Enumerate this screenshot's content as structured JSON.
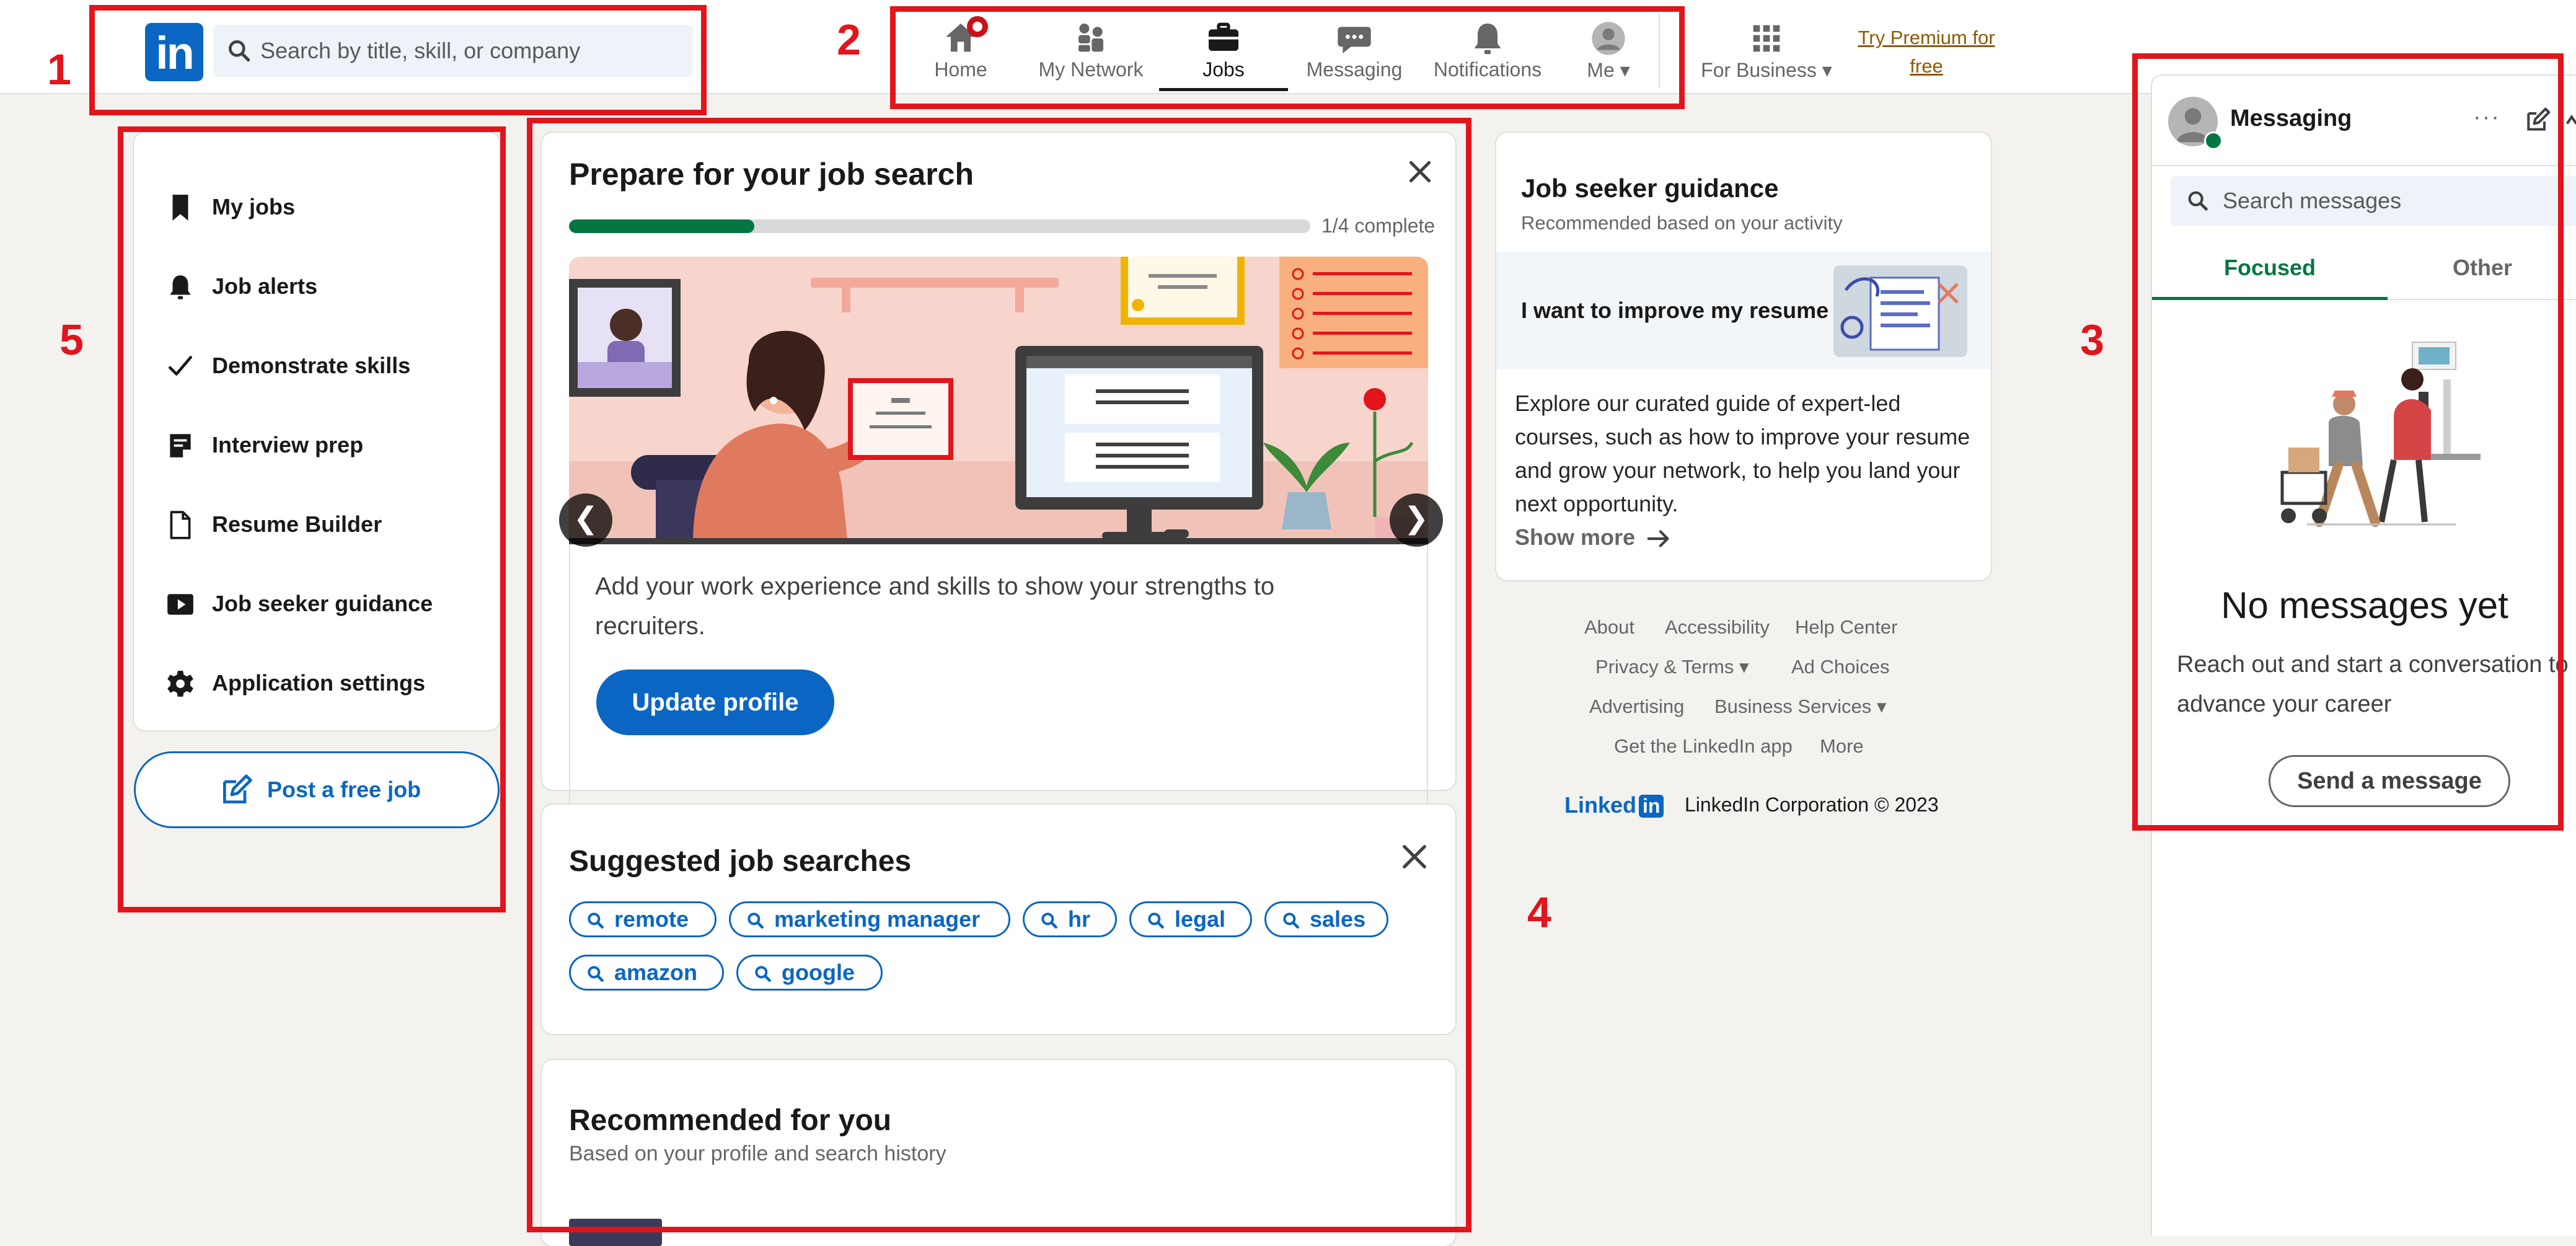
{
  "brand": {
    "logo_text": "in"
  },
  "header": {
    "search_placeholder": "Search by title, skill, or company",
    "nav": [
      {
        "id": "home",
        "label": "Home",
        "icon": "home-icon"
      },
      {
        "id": "network",
        "label": "My Network",
        "icon": "people-icon"
      },
      {
        "id": "jobs",
        "label": "Jobs",
        "icon": "briefcase-icon",
        "active": true
      },
      {
        "id": "messaging",
        "label": "Messaging",
        "icon": "chat-icon"
      },
      {
        "id": "notifications",
        "label": "Notifications",
        "icon": "bell-icon"
      },
      {
        "id": "me",
        "label": "Me",
        "icon": "avatar-icon"
      },
      {
        "id": "business",
        "label": "For Business",
        "icon": "grid-icon"
      }
    ],
    "premium": "Try Premium for free"
  },
  "sidebar": {
    "items": [
      {
        "label": "My jobs",
        "icon": "bookmark-icon"
      },
      {
        "label": "Job alerts",
        "icon": "bell-icon"
      },
      {
        "label": "Demonstrate skills",
        "icon": "checkmark-icon"
      },
      {
        "label": "Interview prep",
        "icon": "clipboard-icon"
      },
      {
        "label": "Resume Builder",
        "icon": "document-icon"
      },
      {
        "label": "Job seeker guidance",
        "icon": "play-icon"
      },
      {
        "label": "Application settings",
        "icon": "gear-icon"
      }
    ],
    "post_job": "Post a free job"
  },
  "prepare": {
    "title": "Prepare for your job search",
    "progress_text": "1/4 complete",
    "progress_fraction": 0.25,
    "description": "Add your work experience and skills to show your strengths to recruiters.",
    "button": "Update profile",
    "prev": "❮",
    "next": "❯"
  },
  "suggested": {
    "title": "Suggested job searches",
    "pills": [
      "remote",
      "marketing manager",
      "hr",
      "legal",
      "sales",
      "amazon",
      "google"
    ]
  },
  "recommended": {
    "title": "Recommended for you",
    "subtitle": "Based on your profile and search history"
  },
  "guidance": {
    "title": "Job seeker guidance",
    "subtitle": "Recommended based on your activity",
    "item": "I want to improve my resume",
    "description": "Explore our curated guide of expert-led courses, such as how to improve your resume and grow your network, to help you land your next opportunity.",
    "show_more": "Show more"
  },
  "footer": {
    "links": [
      "About",
      "Accessibility",
      "Help Center",
      "Privacy & Terms ▾",
      "Ad Choices",
      "Advertising",
      "Business Services ▾",
      "Get the LinkedIn app",
      "More"
    ],
    "logo_text": "Linked",
    "logo_in": "in",
    "copyright": "LinkedIn Corporation © 2023"
  },
  "messaging": {
    "title": "Messaging",
    "more": "···",
    "search_placeholder": "Search messages",
    "tabs": [
      "Focused",
      "Other"
    ],
    "empty_title": "No messages yet",
    "empty_desc": "Reach out and start a conversation to advance your career",
    "button": "Send a message"
  },
  "annotations": [
    "1",
    "2",
    "3",
    "4",
    "5"
  ],
  "colors": {
    "brand": "#0a66c2",
    "success": "#057642",
    "annotation": "#e2141c",
    "premium": "#915907"
  }
}
